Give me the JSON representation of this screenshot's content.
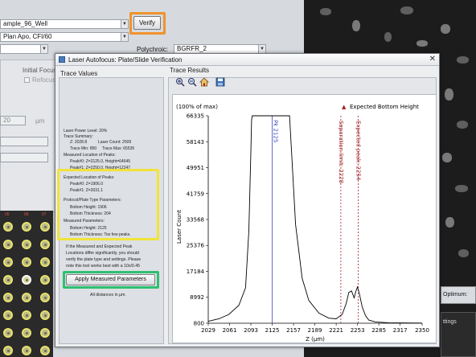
{
  "background_app": {
    "plate_field": "ample_96_Well",
    "objective_field": "Plan Apo, CFI/60",
    "polychroic_label": "Polychroic:",
    "polychroic_value": "BGRFR_2",
    "verify_label": "Verify",
    "initial_focus_label": "Initial Focus",
    "refocus_label": "Refocus",
    "number_value": "20",
    "unit_label": "µm",
    "well_column_labels": [
      "05",
      "06",
      "07"
    ]
  },
  "right_panel": {
    "optimum_label": "Optimum:",
    "settings_label": "ttings"
  },
  "dialog": {
    "title": "Laser Autofocus: Plate/Slide Verification",
    "close_glyph": "✕",
    "trace_values_header": "Trace Values",
    "trace_results_header": "Trace Results",
    "trace_lines": [
      "Laser Power Level: 20%",
      "Trace Summary:",
      "Z: 2028.8          Laser Count: 2509",
      "Trace Min: 850     Trace Max: 65535",
      "Measured Location of Peaks:",
      "Peak#0: Z=2125.0, Height=64645",
      "Peak#1: Z=2250.0, Height=12247"
    ],
    "expected_lines": [
      "Expected Location of Peaks:",
      "Peak#0: Z=1906.0",
      "Peak#1: Z=2031.1",
      "Protocol/Plate Type Parameters:",
      "Bottom Height: 1906",
      "Bottom Thickness: 204",
      "Measured Parameters:",
      "Bottom Height: 2125",
      "Bottom Thickness: Too few peaks."
    ],
    "note_lines": [
      "If the Measured and Expected Peak",
      "Locations differ significantly, you should",
      "verify the plate type and settings. Please",
      "note this tool works best with a 10x/0.45"
    ],
    "apply_button": "Apply Measured Parameters",
    "distances_note": "All distances in µm.",
    "toolbar_icons": [
      "zoom-in-icon",
      "zoom-out-icon",
      "home-icon",
      "save-icon"
    ]
  },
  "colors": {
    "verify_highlight": "#f0932b",
    "expected_highlight": "#f1e33a",
    "apply_highlight": "#2fbf71",
    "peak_marker": "#3b46c4",
    "expected_marker": "#a02028"
  },
  "chart_data": {
    "type": "line",
    "ylabel": "Laser Count",
    "xlabel": "Z (µm)",
    "y_unit_label": "(100% of max)",
    "xlim": [
      2029,
      2350
    ],
    "ylim": [
      800,
      66335
    ],
    "x_ticks": [
      2029,
      2061,
      2093,
      2125,
      2157,
      2189,
      2221,
      2253,
      2285,
      2317,
      2350
    ],
    "y_ticks": [
      800,
      8992,
      17184,
      25376,
      33568,
      41759,
      49951,
      58143,
      66335
    ],
    "series": [
      {
        "x": [
          2029,
          2045,
          2060,
          2075,
          2085,
          2090,
          2093,
          2094,
          2095,
          2110,
          2125,
          2140,
          2150,
          2151,
          2154,
          2160,
          2170,
          2180,
          2195,
          2210,
          2221,
          2230,
          2236,
          2240,
          2244,
          2248,
          2250,
          2253,
          2256,
          2260,
          2265,
          2270,
          2280,
          2300,
          2320,
          2350
        ],
        "y": [
          1400,
          2200,
          3600,
          6500,
          12000,
          30000,
          55000,
          65000,
          66335,
          66335,
          66335,
          66335,
          66335,
          66335,
          55000,
          32000,
          15000,
          8000,
          4000,
          2400,
          2200,
          3600,
          7000,
          10500,
          11000,
          8800,
          10500,
          12247,
          10000,
          6000,
          3200,
          1800,
          1200,
          950,
          900,
          850
        ]
      }
    ],
    "markers": [
      {
        "label": "Pk 2125",
        "x": 2125
      },
      {
        "label": "Separation limit: 2228",
        "x": 2228
      },
      {
        "label": "Expected peak: 2254",
        "x": 2254
      }
    ],
    "legend": {
      "label": "Expected Bottom Height",
      "glyph": "▲",
      "position": "top-right"
    }
  }
}
